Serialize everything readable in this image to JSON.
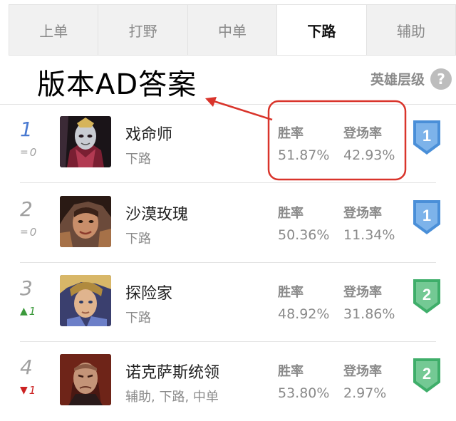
{
  "tabs": [
    {
      "label": "上单",
      "active": false
    },
    {
      "label": "打野",
      "active": false
    },
    {
      "label": "中单",
      "active": false
    },
    {
      "label": "下路",
      "active": true
    },
    {
      "label": "辅助",
      "active": false
    }
  ],
  "headline": "版本AD答案",
  "tier_header": {
    "label": "英雄层级",
    "help_symbol": "?"
  },
  "stat_labels": {
    "win_rate": "胜率",
    "pick_rate": "登场率"
  },
  "colors": {
    "tier_blue": "#4a8fd8",
    "tier_green": "#3fae6a",
    "annotation_red": "#d9342b",
    "rank_first": "#4a7ad1"
  },
  "rows": [
    {
      "rank": "1",
      "trend_symbol": "=",
      "trend_value": "0",
      "trend": "same",
      "name": "戏命师",
      "role": "下路",
      "win_rate": "51.87%",
      "pick_rate": "42.93%",
      "tier": "1",
      "portrait": "jhin-portrait"
    },
    {
      "rank": "2",
      "trend_symbol": "=",
      "trend_value": "0",
      "trend": "same",
      "name": "沙漠玫瑰",
      "role": "下路",
      "win_rate": "50.36%",
      "pick_rate": "11.34%",
      "tier": "1",
      "portrait": "samira-portrait"
    },
    {
      "rank": "3",
      "trend_symbol": "▲",
      "trend_value": "1",
      "trend": "up",
      "name": "探险家",
      "role": "下路",
      "win_rate": "48.92%",
      "pick_rate": "31.86%",
      "tier": "2",
      "portrait": "ezreal-portrait"
    },
    {
      "rank": "4",
      "trend_symbol": "▼",
      "trend_value": "1",
      "trend": "down",
      "name": "诺克萨斯统领",
      "role": "辅助, 下路, 中单",
      "win_rate": "53.80%",
      "pick_rate": "2.97%",
      "tier": "2",
      "portrait": "swain-portrait"
    }
  ]
}
